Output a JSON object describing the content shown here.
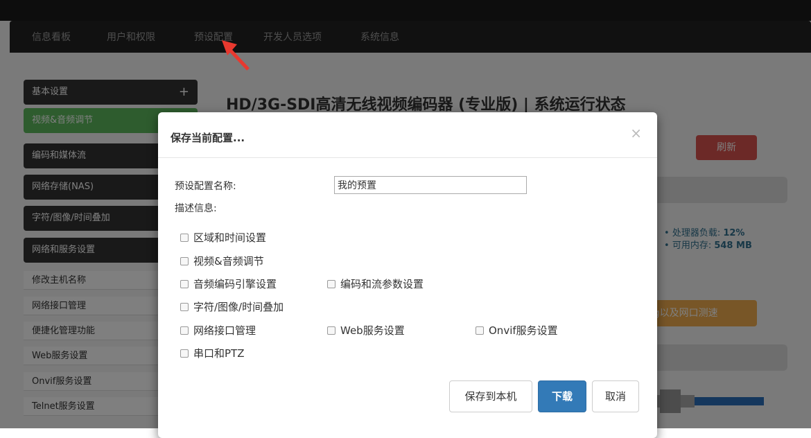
{
  "navbar": {
    "items": [
      "信息看板",
      "用户和权限",
      "预设配置",
      "开发人员选项",
      "系统信息"
    ]
  },
  "sidebar": {
    "sections": [
      "基本设置",
      "视频&音频调节",
      "编码和媒体流",
      "网络存储(NAS)",
      "字符/图像/时间叠加",
      "网络和服务设置"
    ],
    "plus": "+",
    "links": [
      "修改主机名称",
      "网络接口管理",
      "便捷化管理功能",
      "Web服务设置",
      "Onvif服务设置",
      "Telnet服务设置"
    ]
  },
  "page": {
    "title": "HD/3G-SDI高清无线视频编码器 (专业版) | 系统运行状态",
    "refresh_label": "刷新",
    "cpu_label": "处理器负载:",
    "cpu_value": "12%",
    "mem_label": "可用内存:",
    "mem_value": "548 MB",
    "ping_label": "ing以及网口测速"
  },
  "modal": {
    "title": "保存当前配置...",
    "close": "×",
    "name_label": "预设配置名称:",
    "name_value": "我的预置",
    "desc_label": "描述信息:",
    "options": [
      "区域和时间设置",
      "视频&音频调节",
      "音频编码引擎设置",
      "编码和流参数设置",
      "字符/图像/时间叠加",
      "网络接口管理",
      "Web服务设置",
      "Onvif服务设置",
      "串口和PTZ"
    ],
    "save_local_label": "保存到本机",
    "download_label": "下载",
    "cancel_label": "取消"
  },
  "colors": {
    "navbar": "#222222",
    "active_section": "#5cb85c",
    "primary": "#337ab7",
    "arrow": "#e8392f"
  }
}
